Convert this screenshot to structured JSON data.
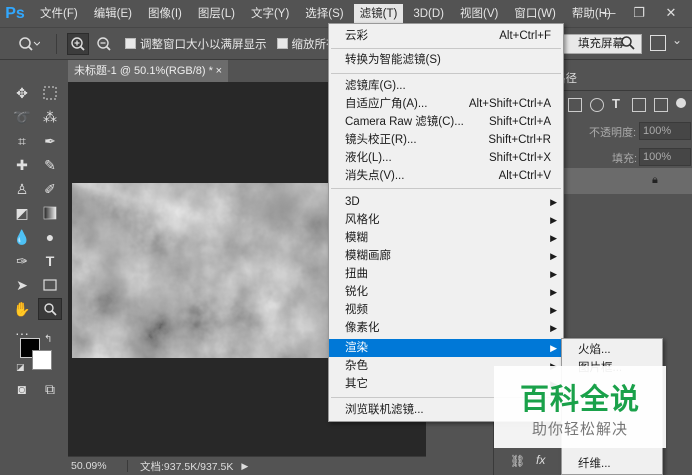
{
  "app": {
    "logo": "Ps"
  },
  "menubar": [
    "文件(F)",
    "编辑(E)",
    "图像(I)",
    "图层(L)",
    "文字(Y)",
    "选择(S)",
    "滤镜(T)",
    "3D(D)",
    "视图(V)",
    "窗口(W)",
    "帮助(H)"
  ],
  "window_controls": {
    "minimize": "—",
    "restore": "❐",
    "close": "✕"
  },
  "options": {
    "resize_windows": "调整窗口大小以满屏显示",
    "zoom_all": "缩放所有",
    "fill_screen": "填充屏幕"
  },
  "document": {
    "tab_title": "未标题-1 @ 50.1%(RGB/8) *",
    "tab_close": "×"
  },
  "status": {
    "zoom": "50.09%",
    "doc_info": "文档:937.5K/937.5K"
  },
  "panel": {
    "tab_label": "路径",
    "opacity_label": "不透明度:",
    "opacity_value": "100%",
    "fill_label": "填充:",
    "fill_value": "100%"
  },
  "filter_menu": {
    "items": [
      {
        "label": "云彩",
        "shortcut": "Alt+Ctrl+F"
      },
      {
        "label": "转换为智能滤镜(S)",
        "shortcut": ""
      },
      {
        "label": "滤镜库(G)...",
        "shortcut": ""
      },
      {
        "label": "自适应广角(A)...",
        "shortcut": "Alt+Shift+Ctrl+A"
      },
      {
        "label": "Camera Raw 滤镜(C)...",
        "shortcut": "Shift+Ctrl+A"
      },
      {
        "label": "镜头校正(R)...",
        "shortcut": "Shift+Ctrl+R"
      },
      {
        "label": "液化(L)...",
        "shortcut": "Shift+Ctrl+X"
      },
      {
        "label": "消失点(V)...",
        "shortcut": "Alt+Ctrl+V"
      },
      {
        "label": "3D",
        "shortcut": ""
      },
      {
        "label": "风格化",
        "shortcut": ""
      },
      {
        "label": "模糊",
        "shortcut": ""
      },
      {
        "label": "模糊画廊",
        "shortcut": ""
      },
      {
        "label": "扭曲",
        "shortcut": ""
      },
      {
        "label": "锐化",
        "shortcut": ""
      },
      {
        "label": "视频",
        "shortcut": ""
      },
      {
        "label": "像素化",
        "shortcut": ""
      },
      {
        "label": "渲染",
        "shortcut": ""
      },
      {
        "label": "杂色",
        "shortcut": ""
      },
      {
        "label": "其它",
        "shortcut": ""
      },
      {
        "label": "浏览联机滤镜...",
        "shortcut": ""
      }
    ]
  },
  "render_submenu": {
    "items": [
      "火焰...",
      "图片框...",
      "纤维..."
    ]
  },
  "watermark": {
    "title": "百科全说",
    "subtitle": "助你轻松解决"
  },
  "colors": {
    "accent": "#0078d7",
    "ps_blue": "#31a8ff",
    "watermark_green": "#1aa14a"
  }
}
